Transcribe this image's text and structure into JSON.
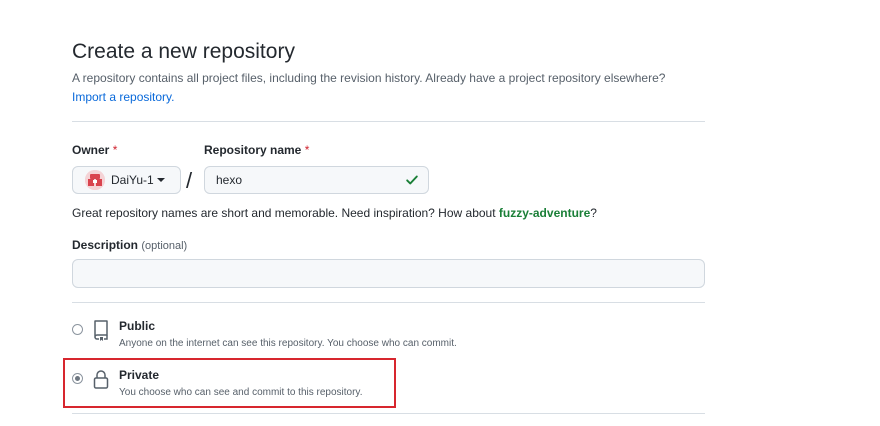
{
  "header": {
    "title": "Create a new repository",
    "description": "A repository contains all project files, including the revision history. Already have a project repository elsewhere?",
    "import_link": "Import a repository."
  },
  "owner": {
    "label": "Owner",
    "required_mark": "*",
    "selected": "DaiYu-1"
  },
  "separator": "/",
  "repo_name": {
    "label": "Repository name",
    "required_mark": "*",
    "value": "hexo"
  },
  "hint": {
    "text": "Great repository names are short and memorable. Need inspiration? How about ",
    "suggestion": "fuzzy-adventure",
    "end": "?"
  },
  "description_field": {
    "label": "Description",
    "optional": "(optional)",
    "value": ""
  },
  "visibility": {
    "public": {
      "title": "Public",
      "desc": "Anyone on the internet can see this repository. You choose who can commit.",
      "selected": false
    },
    "private": {
      "title": "Private",
      "desc": "You choose who can see and commit to this repository.",
      "selected": true
    }
  },
  "colors": {
    "link": "#0969da",
    "required": "#cf222e",
    "success": "#1a7f37",
    "highlight": "#d7262e"
  },
  "icons": {
    "valid": "check-icon",
    "public": "repo-book-icon",
    "private": "lock-icon"
  }
}
